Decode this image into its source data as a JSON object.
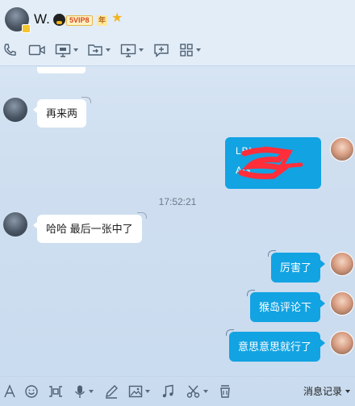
{
  "header": {
    "contact_name": "W.",
    "vip_label": "5VIP8",
    "year_label": "年",
    "icons": [
      "phone-icon",
      "video-icon",
      "screen-share-icon",
      "file-transfer-icon",
      "remote-desktop-icon",
      "add-chat-icon",
      "apps-icon"
    ]
  },
  "chat": {
    "clipped_text": "“   ”",
    "messages": [
      {
        "side": "left",
        "text": "再来两"
      },
      {
        "side": "right",
        "type": "image",
        "line1": "LBk",
        "line2": "AG"
      },
      {
        "side": "left",
        "text": "哈哈 最后一张中了"
      },
      {
        "side": "right",
        "text": "厉害了"
      },
      {
        "side": "right",
        "text": "猴岛评论下"
      },
      {
        "side": "right",
        "text": "意思意思就行了"
      }
    ],
    "timestamp": "17:52:21"
  },
  "input_toolbar": {
    "history_label": "消息记录",
    "icons": [
      "font-icon",
      "emoji-icon",
      "gif-icon",
      "voice-icon",
      "pen-icon",
      "image-icon",
      "music-icon",
      "scissors-icon",
      "clear-icon"
    ]
  },
  "colors": {
    "bubble_self": "#12a3e3",
    "bubble_other": "#ffffff",
    "header_bg": "#e3edf8"
  }
}
